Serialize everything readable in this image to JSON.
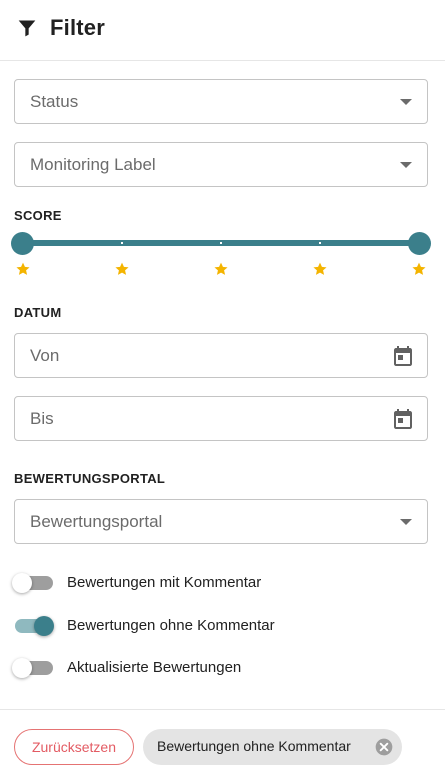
{
  "header": {
    "title": "Filter",
    "icon": "filter-icon"
  },
  "fields": {
    "status": {
      "placeholder": "Status"
    },
    "monitoring_label": {
      "placeholder": "Monitoring Label"
    },
    "date_from": {
      "placeholder": "Von"
    },
    "date_to": {
      "placeholder": "Bis"
    },
    "portal": {
      "placeholder": "Bewertungsportal"
    }
  },
  "sections": {
    "score": "SCORE",
    "date": "DATUM",
    "portal": "BEWERTUNGSPORTAL"
  },
  "score_slider": {
    "min": 1,
    "max": 5,
    "selected_min": 1,
    "selected_max": 5,
    "star_color": "#f4b400",
    "accent": "#3b7f8b"
  },
  "toggles": [
    {
      "label": "Bewertungen mit Kommentar",
      "on": false
    },
    {
      "label": "Bewertungen ohne Kommentar",
      "on": true
    },
    {
      "label": "Aktualisierte Bewertungen",
      "on": false
    }
  ],
  "footer": {
    "reset_label": "Zurücksetzen",
    "chip_label": "Bewertungen ohne Kommentar"
  }
}
